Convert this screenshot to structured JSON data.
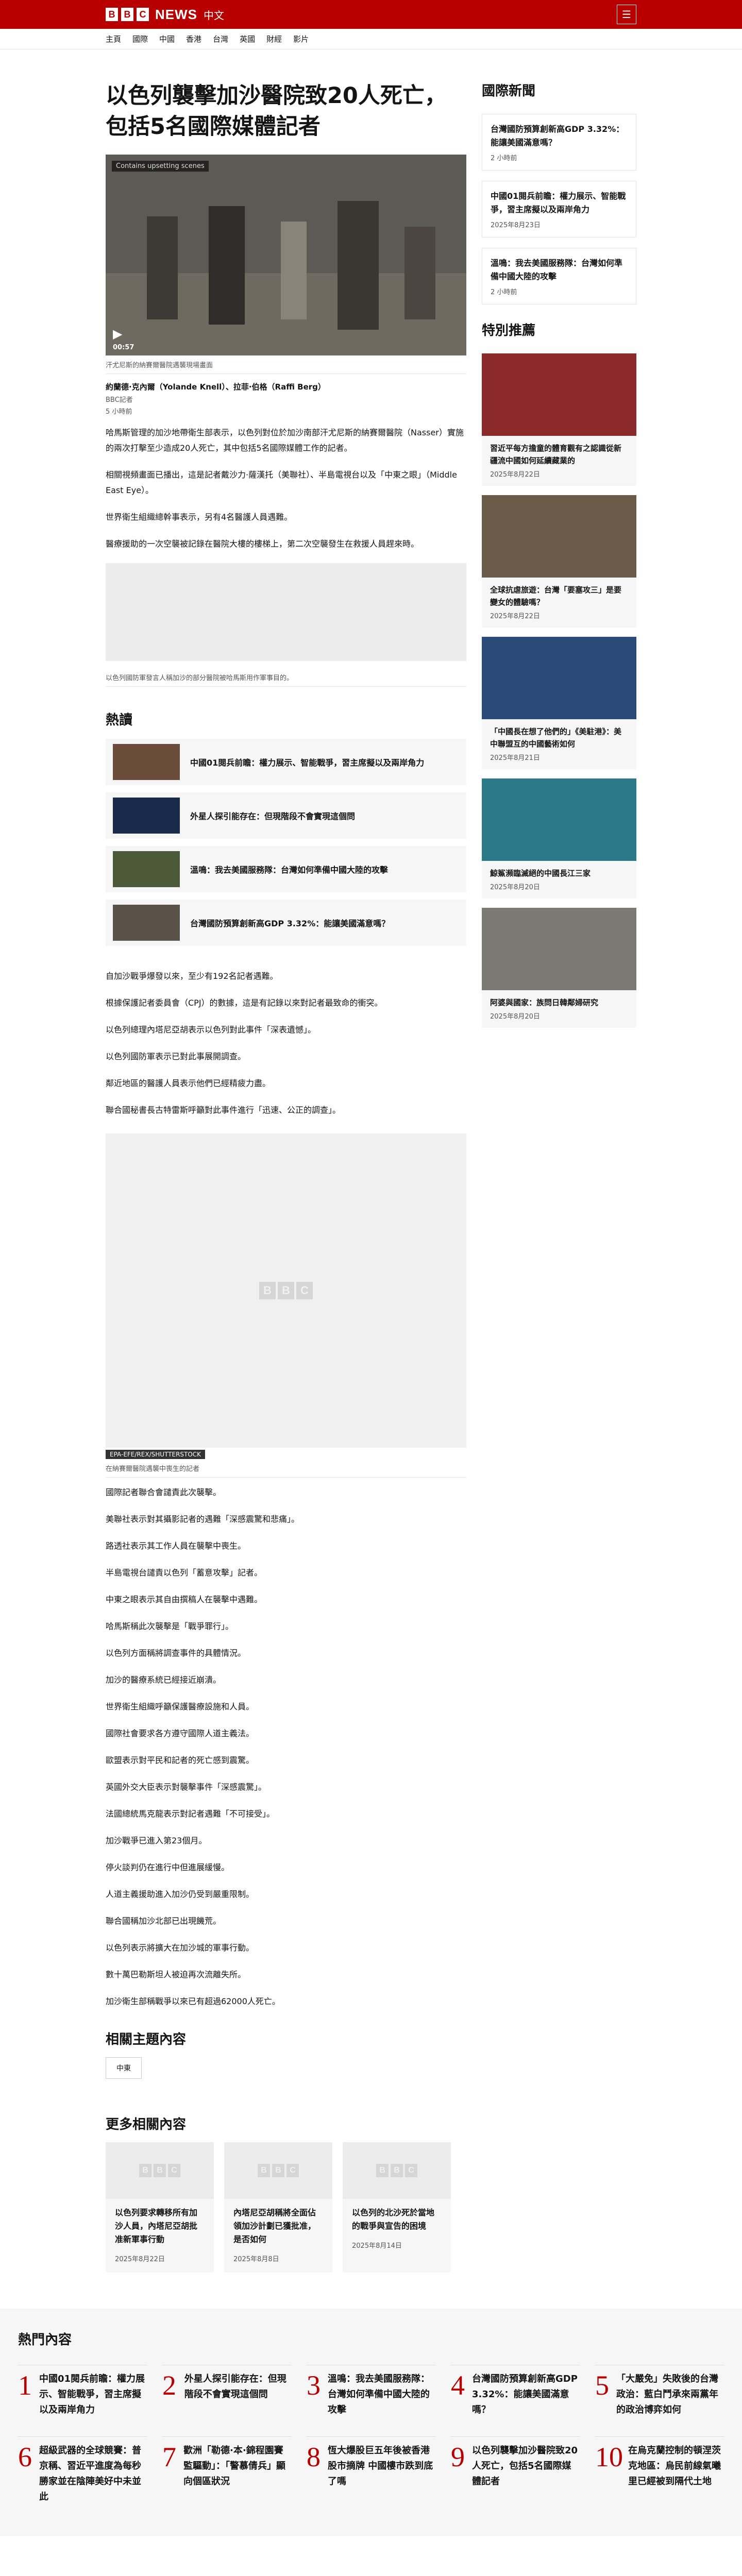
{
  "site": {
    "block1": "B",
    "block2": "B",
    "block3": "C",
    "name": "NEWS",
    "sub": "中文",
    "menu": "☰"
  },
  "nav": [
    "主頁",
    "國際",
    "中國",
    "香港",
    "台灣",
    "英國",
    "財經",
    "影片"
  ],
  "article": {
    "title": "以色列襲擊加沙醫院致20人死亡，包括5名國際媒體記者",
    "video_tag": "Contains upsetting scenes",
    "video_duration": "00:57",
    "video_caption": "汗尤尼斯的納賽爾醫院遇襲現場畫面",
    "byline": "約蘭德·克內爾（Yolande Knell）、拉菲·伯格（Raffi Berg）",
    "bysub": "BBC記者",
    "date": "5 小時前",
    "paras1": [
      "哈馬斯管理的加沙地帶衛生部表示，以色列對位於加沙南部汗尤尼斯的納賽爾醫院（Nasser）實施的兩次打擊至少造成20人死亡，其中包括5名國際媒體工作的記者。",
      "相關視頻畫面已播出，這是記者戴沙力·薩漢托（美聯社）、半島電視台以及「中東之眼」（Middle East Eye）。",
      "世界衛生組織總幹事表示，另有4名醫護人員遇難。",
      "醫療援助的一次空襲被記錄在醫院大樓的樓梯上，第二次空襲發生在救援人員趕來時。"
    ],
    "ad_caption": "以色列國防軍發言人稱加沙的部分醫院被哈馬斯用作軍事目的。",
    "paras2": [
      "自加沙戰爭爆發以來，至少有192名記者遇難。",
      "根據保護記者委員會（CPJ）的數據，這是有記錄以來對記者最致命的衝突。",
      "以色列總理內塔尼亞胡表示以色列對此事件「深表遺憾」。",
      "以色列國防軍表示已對此事展開調查。",
      "鄰近地區的醫護人員表示他們已經精疲力盡。",
      "聯合國秘書長古特雷斯呼籲對此事件進行「迅速、公正的調查」。"
    ],
    "photo_credit": "EPA-EFE/REX/SHUTTERSTOCK",
    "photo_caption": "在納賽爾醫院遇襲中喪生的記者",
    "paras3": [
      "國際記者聯合會譴責此次襲擊。",
      "美聯社表示對其攝影記者的遇難「深感震驚和悲痛」。",
      "路透社表示其工作人員在襲擊中喪生。",
      "半島電視台譴責以色列「蓄意攻擊」記者。",
      "中東之眼表示其自由撰稿人在襲擊中遇難。",
      "哈馬斯稱此次襲擊是「戰爭罪行」。",
      "以色列方面稱將調查事件的具體情況。",
      "加沙的醫療系統已經接近崩潰。",
      "世界衛生組織呼籲保護醫療設施和人員。",
      "國際社會要求各方遵守國際人道主義法。",
      "歐盟表示對平民和記者的死亡感到震驚。",
      "英國外交大臣表示對襲擊事件「深感震驚」。",
      "法國總統馬克龍表示對記者遇難「不可接受」。",
      "加沙戰爭已進入第23個月。",
      "停火談判仍在進行中但進展緩慢。",
      "人道主義援助進入加沙仍受到嚴重限制。",
      "聯合國稱加沙北部已出現饑荒。",
      "以色列表示將擴大在加沙城的軍事行動。",
      "數十萬巴勒斯坦人被迫再次流離失所。",
      "加沙衛生部稱戰爭以來已有超過62000人死亡。"
    ]
  },
  "hot": {
    "title": "熱讀",
    "items": [
      "中國01閱兵前瞻：權力展示、智能戰爭，習主席擬以及兩岸角力",
      "外星人探引能存在：但現階段不會實現這個問",
      "溫鳴：我去美國服務隊：台灣如何準備中國大陸的攻擊",
      "台灣國防預算創新高GDP 3.32%：能讓美國滿意嗎？"
    ]
  },
  "related": {
    "title": "相關主題內容",
    "tag": "中東"
  },
  "more": {
    "title": "更多相關內容",
    "cards": [
      {
        "t": "以色列要求轉移所有加沙人員，內塔尼亞胡批准新軍事行動",
        "d": "2025年8月22日"
      },
      {
        "t": "內塔尼亞胡稱將全面佔領加沙計劃已獲批准，是否如何",
        "d": "2025年8月8日"
      },
      {
        "t": "以色列的北沙死於當地的戰爭與宣告的困境",
        "d": "2025年8月14日"
      }
    ]
  },
  "side": {
    "title": "國際新聞",
    "items": [
      {
        "t": "台灣國防預算創新高GDP 3.32%：能讓美國滿意嗎？",
        "d": "2 小時前"
      },
      {
        "t": "中國01閱兵前瞻：權力展示、智能戰爭，習主席擬以及兩岸角力",
        "d": "2025年8月23日"
      },
      {
        "t": "溫鳴：我去美國服務隊：台灣如何準備中國大陸的攻擊",
        "d": "2 小時前"
      }
    ],
    "feat_title": "特別推薦",
    "feats": [
      {
        "t": "習近平每方擔童的體育觀有之認識從新疆流中國如何延續藏業的",
        "d": "2025年8月22日"
      },
      {
        "t": "全球抗虐旅遊：台灣「要塞攻三」是要變女的體驗嗎？",
        "d": "2025年8月22日"
      },
      {
        "t": "「中國長在想了他們的」《美駐港》：美中聯盟互的中國藝術如何",
        "d": "2025年8月21日"
      },
      {
        "t": "鯨鯊瀕臨滅絕的中國長江三家",
        "d": "2025年8月20日"
      },
      {
        "t": "阿婆與國家：族問日韓鄰婦研究",
        "d": "2025年8月20日"
      }
    ]
  },
  "mostread": {
    "title": "熱門內容",
    "items": [
      {
        "n": "1",
        "t": "中國01閱兵前瞻：權力展示、智能戰爭，習主席擬以及兩岸角力"
      },
      {
        "n": "2",
        "t": "外星人探引能存在：但現階段不會實現這個問"
      },
      {
        "n": "3",
        "t": "溫鳴：我去美國服務隊：台灣如何準備中國大陸的攻擊"
      },
      {
        "n": "4",
        "t": "台灣國防預算創新高GDP 3.32%：能讓美國滿意嗎？"
      },
      {
        "n": "5",
        "t": "「大嚴免」失敗後的台灣政治：藍白鬥承來兩黨年的政治博弈如何"
      },
      {
        "n": "6",
        "t": "超級武器的全球競賽：普京稱、習近平進度為每秒勝家並在陰陣美好中未並此"
      },
      {
        "n": "7",
        "t": "歡洲「勒德·本·錦程園賽監驅動」：「警慕倩兵」顯向個區狀況"
      },
      {
        "n": "8",
        "t": "恆大爆股巨五年後被香港股市摘牌 中國樓市跌到底了嗎"
      },
      {
        "n": "9",
        "t": "以色列襲擊加沙醫院致20人死亡，包括5名國際媒體記者"
      },
      {
        "n": "10",
        "t": "在烏克蘭控制的頓涅茨克地區：烏民前線氣曦里已經被到隔代土地"
      }
    ]
  }
}
